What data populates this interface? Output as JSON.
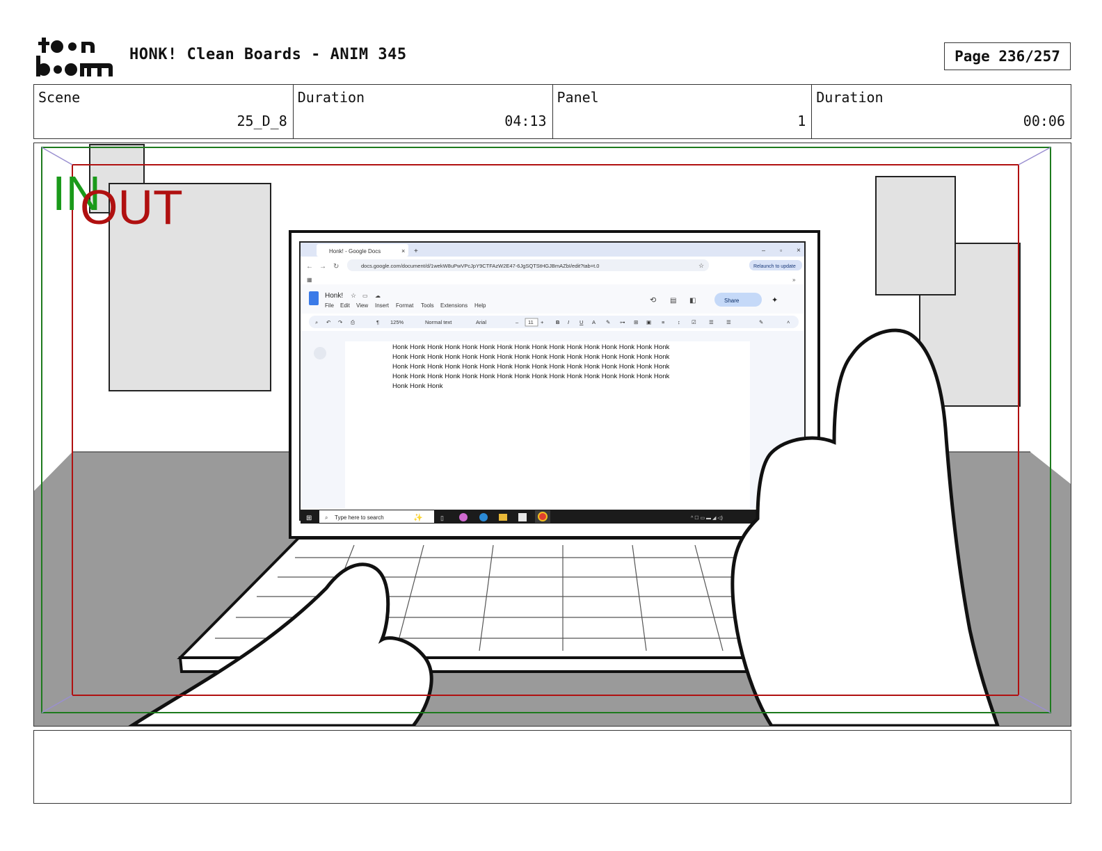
{
  "header": {
    "logo_text": "toon boom",
    "title": "HONK! Clean Boards - ANIM 345",
    "page": "Page 236/257"
  },
  "info": [
    {
      "label": "Scene",
      "value": "25_D_8"
    },
    {
      "label": "Duration",
      "value": "04:13"
    },
    {
      "label": "Panel",
      "value": "1"
    },
    {
      "label": "Duration",
      "value": "00:06"
    }
  ],
  "safe_frames": {
    "in_label": "IN",
    "out_label": "OUT",
    "in_color": "#1a9a1a",
    "out_color": "#b01010"
  },
  "browser": {
    "tab_title": "Honk! - Google Docs",
    "url": "docs.google.com/document/d/1wekW8uPwVPcJpY9CTFAzW2E47-6JgSQTStHGJBmAZbI/edit?tab=t.0",
    "relaunch": "Relaunch to update"
  },
  "docs": {
    "doc_title": "Honk!",
    "menu": [
      "File",
      "Edit",
      "View",
      "Insert",
      "Format",
      "Tools",
      "Extensions",
      "Help"
    ],
    "share": "Share",
    "zoom": "125%",
    "style": "Normal text",
    "font": "Arial",
    "font_size": "11",
    "body_lines": [
      "Honk Honk Honk Honk Honk Honk Honk Honk Honk Honk Honk Honk Honk Honk Honk Honk",
      "Honk Honk Honk Honk Honk Honk Honk Honk Honk Honk Honk Honk Honk Honk Honk Honk",
      "Honk Honk Honk Honk Honk Honk Honk Honk Honk Honk Honk Honk Honk Honk Honk Honk",
      "Honk Honk Honk Honk Honk Honk Honk Honk Honk Honk Honk Honk Honk Honk Honk Honk",
      "Honk Honk Honk"
    ]
  },
  "taskbar": {
    "search_placeholder": "Type here to search"
  },
  "notes": ""
}
